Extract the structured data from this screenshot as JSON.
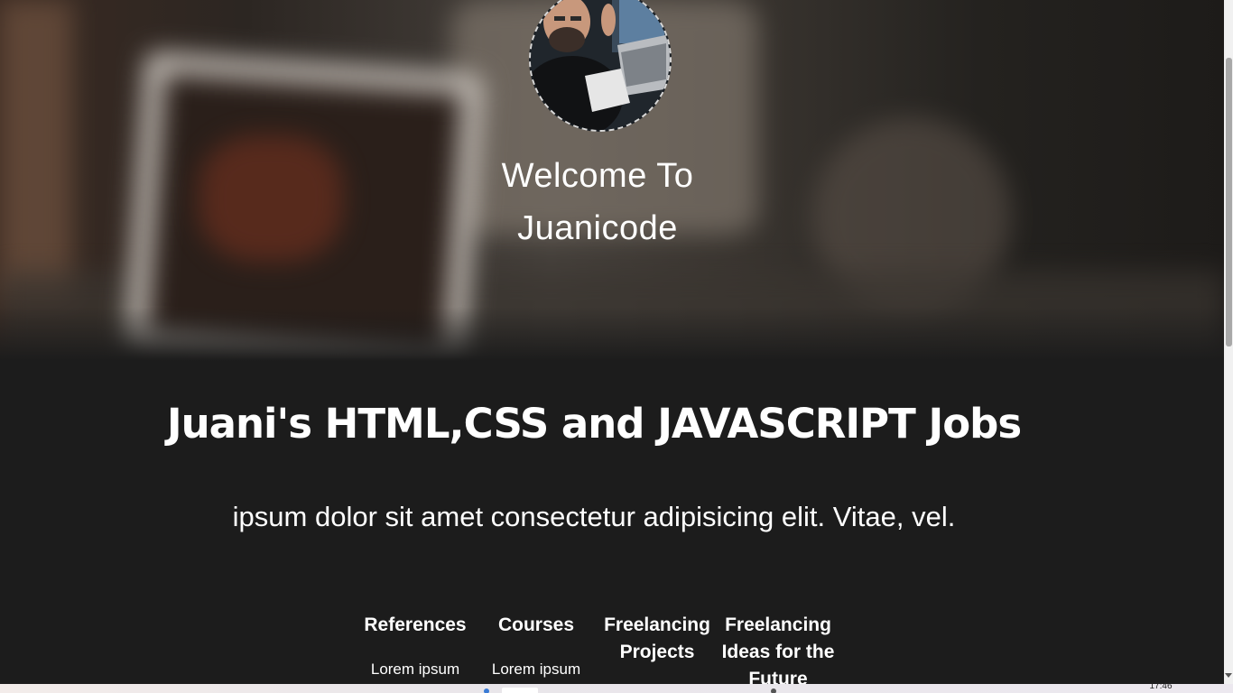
{
  "hero": {
    "welcome_line1": "Welcome To",
    "welcome_line2": "Juanicode",
    "avatar_icon": "profile-photo"
  },
  "main": {
    "title": "Juani's HTML,CSS and JAVASCRIPT Jobs",
    "subtitle": "ipsum dolor sit amet consectetur adipisicing elit. Vitae, vel."
  },
  "sections": [
    {
      "heading": "References",
      "text": "Lorem ipsum"
    },
    {
      "heading": "Courses",
      "text": "Lorem ipsum"
    },
    {
      "heading": "Freelancing Projects",
      "text": ""
    },
    {
      "heading": "Freelancing Ideas for the Future",
      "text": ""
    }
  ],
  "taskbar": {
    "clock": "17:46"
  },
  "colors": {
    "page_background": "#1c1c1c",
    "text": "#ffffff",
    "scrollbar_thumb": "#a8a8a8"
  }
}
